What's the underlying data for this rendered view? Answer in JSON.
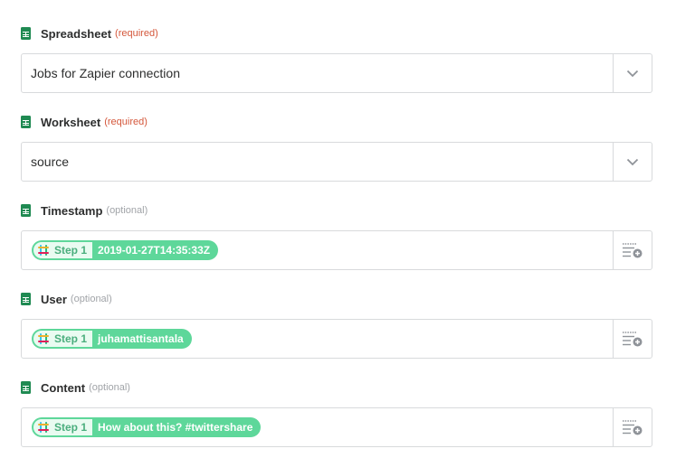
{
  "fields": [
    {
      "label": "Spreadsheet",
      "tag": "(required)",
      "value": "Jobs for Zapier connection"
    },
    {
      "label": "Worksheet",
      "tag": "(required)",
      "value": "source"
    },
    {
      "label": "Timestamp",
      "tag": "(optional)",
      "step": "Step 1",
      "value": "2019-01-27T14:35:33Z"
    },
    {
      "label": "User",
      "tag": "(optional)",
      "step": "Step 1",
      "value": "juhamattisantala"
    },
    {
      "label": "Content",
      "tag": "(optional)",
      "step": "Step 1",
      "value": "How about this? #twittershare"
    }
  ],
  "icons": {
    "field": "google-sheets-icon",
    "select": "chevron-down-icon",
    "insert": "insert-data-icon",
    "source_app": "slack-icon"
  },
  "colors": {
    "required": "#d4573b",
    "optional": "#a1a4a8",
    "pill": "#5ed79a",
    "sheets_green": "#1f8a52"
  }
}
